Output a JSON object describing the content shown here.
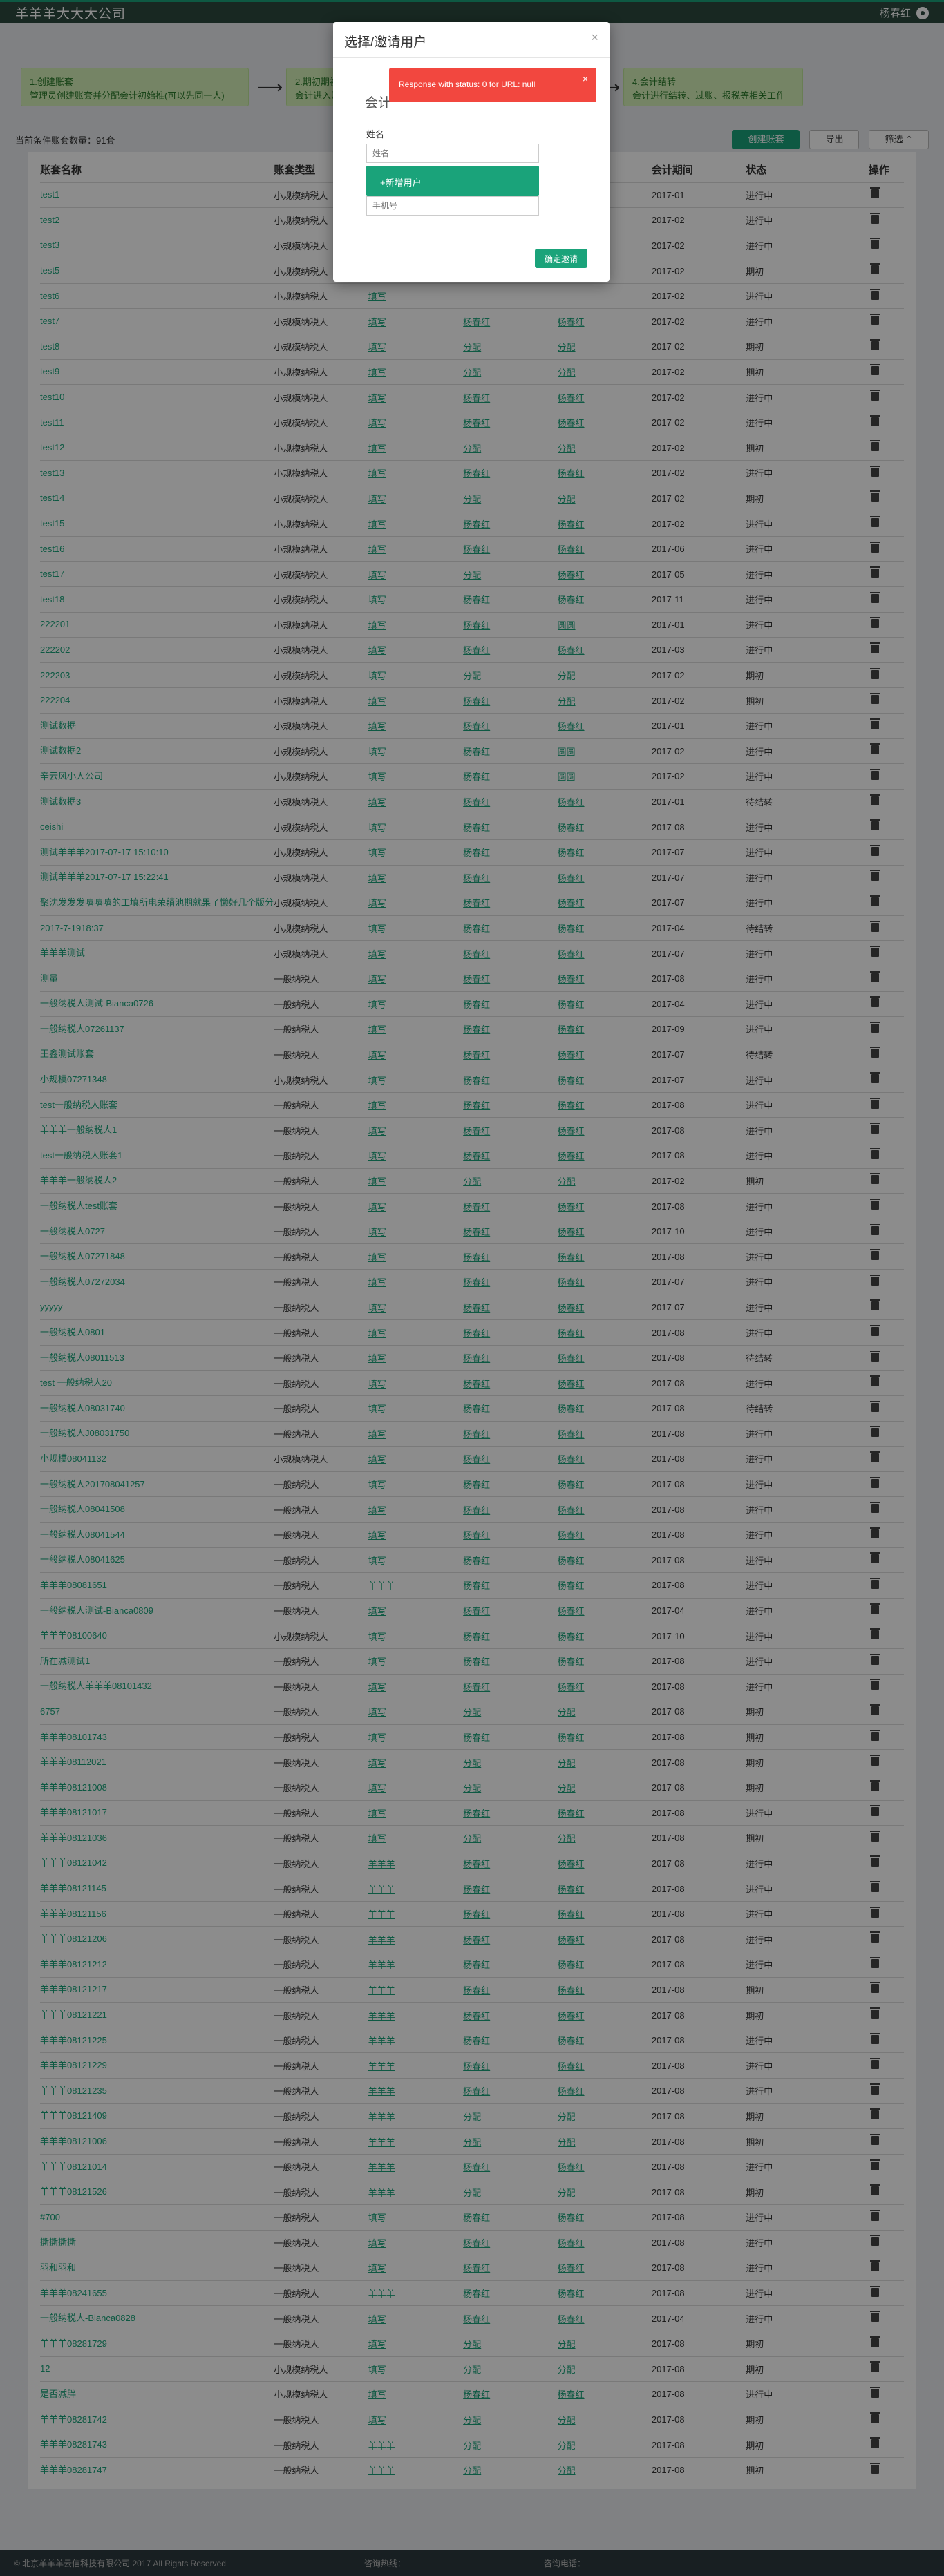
{
  "header": {
    "company": "羊羊羊大大大公司",
    "user": "杨春红"
  },
  "flow": [
    "1.创建账套\n管理员创建账套并分配会计初始推(可以先同一人)",
    "2.期初期初\n会计进入账套...",
    "",
    "4.会计结转\n会计进行结转、过账、报税等相关工作"
  ],
  "toolbar": {
    "count": "当前条件账套数量：91套",
    "create": "创建账套",
    "export": "导出",
    "filter": "筛选 ⌃"
  },
  "table": {
    "headers": [
      "账套名称",
      "账套类型",
      "",
      "",
      "",
      "会计期间",
      "状态",
      "操作"
    ],
    "rows": [
      [
        "test1",
        "小规模纳税人",
        "填写",
        "",
        "",
        "2017-01",
        "进行中"
      ],
      [
        "test2",
        "小规模纳税人",
        "填写",
        "",
        "",
        "2017-02",
        "进行中"
      ],
      [
        "test3",
        "小规模纳税人",
        "填写",
        "",
        "",
        "2017-02",
        "进行中"
      ],
      [
        "test5",
        "小规模纳税人",
        "填写",
        "",
        "",
        "2017-02",
        "期初"
      ],
      [
        "test6",
        "小规模纳税人",
        "填写",
        "",
        "",
        "2017-02",
        "进行中"
      ],
      [
        "test7",
        "小规模纳税人",
        "填写",
        "杨春红",
        "杨春红",
        "2017-02",
        "进行中"
      ],
      [
        "test8",
        "小规模纳税人",
        "填写",
        "分配",
        "分配",
        "2017-02",
        "期初"
      ],
      [
        "test9",
        "小规模纳税人",
        "填写",
        "分配",
        "分配",
        "2017-02",
        "期初"
      ],
      [
        "test10",
        "小规模纳税人",
        "填写",
        "杨春红",
        "杨春红",
        "2017-02",
        "进行中"
      ],
      [
        "test11",
        "小规模纳税人",
        "填写",
        "杨春红",
        "杨春红",
        "2017-02",
        "进行中"
      ],
      [
        "test12",
        "小规模纳税人",
        "填写",
        "分配",
        "分配",
        "2017-02",
        "期初"
      ],
      [
        "test13",
        "小规模纳税人",
        "填写",
        "杨春红",
        "杨春红",
        "2017-02",
        "进行中"
      ],
      [
        "test14",
        "小规模纳税人",
        "填写",
        "分配",
        "分配",
        "2017-02",
        "期初"
      ],
      [
        "test15",
        "小规模纳税人",
        "填写",
        "杨春红",
        "杨春红",
        "2017-02",
        "进行中"
      ],
      [
        "test16",
        "小规模纳税人",
        "填写",
        "杨春红",
        "杨春红",
        "2017-06",
        "进行中"
      ],
      [
        "test17",
        "小规模纳税人",
        "填写",
        "分配",
        "杨春红",
        "2017-05",
        "进行中"
      ],
      [
        "test18",
        "小规模纳税人",
        "填写",
        "杨春红",
        "杨春红",
        "2017-11",
        "进行中"
      ],
      [
        "222201",
        "小规模纳税人",
        "填写",
        "杨春红",
        "圆圆",
        "2017-01",
        "进行中"
      ],
      [
        "222202",
        "小规模纳税人",
        "填写",
        "杨春红",
        "杨春红",
        "2017-03",
        "进行中"
      ],
      [
        "222203",
        "小规模纳税人",
        "填写",
        "分配",
        "分配",
        "2017-02",
        "期初"
      ],
      [
        "222204",
        "小规模纳税人",
        "填写",
        "杨春红",
        "分配",
        "2017-02",
        "期初"
      ],
      [
        "测试数据",
        "小规模纳税人",
        "填写",
        "杨春红",
        "杨春红",
        "2017-01",
        "进行中"
      ],
      [
        "测试数据2",
        "小规模纳税人",
        "填写",
        "杨春红",
        "圆圆",
        "2017-02",
        "进行中"
      ],
      [
        "辛云风小人公司",
        "小规模纳税人",
        "填写",
        "杨春红",
        "圆圆",
        "2017-02",
        "进行中"
      ],
      [
        "测试数据3",
        "小规模纳税人",
        "填写",
        "杨春红",
        "杨春红",
        "2017-01",
        "待结转"
      ],
      [
        "ceishi",
        "小规模纳税人",
        "填写",
        "杨春红",
        "杨春红",
        "2017-08",
        "进行中"
      ],
      [
        "测试羊羊羊2017-07-17 15:10:10",
        "小规模纳税人",
        "填写",
        "杨春红",
        "杨春红",
        "2017-07",
        "进行中"
      ],
      [
        "测试羊羊羊2017-07-17 15:22:41",
        "小规模纳税人",
        "填写",
        "杨春红",
        "杨春红",
        "2017-07",
        "进行中"
      ],
      [
        "聚沈发发发嘻嘻嘻的工填所电荣躺池期就果了懒好几个版分",
        "小规模纳税人",
        "填写",
        "杨春红",
        "杨春红",
        "2017-07",
        "进行中"
      ],
      [
        "2017-7-1918:37",
        "小规模纳税人",
        "填写",
        "杨春红",
        "杨春红",
        "2017-04",
        "待结转"
      ],
      [
        "羊羊羊测试",
        "小规模纳税人",
        "填写",
        "杨春红",
        "杨春红",
        "2017-07",
        "进行中"
      ],
      [
        "测量",
        "一般纳税人",
        "填写",
        "杨春红",
        "杨春红",
        "2017-08",
        "进行中"
      ],
      [
        "一般纳税人测试-Bianca0726",
        "一般纳税人",
        "填写",
        "杨春红",
        "杨春红",
        "2017-04",
        "进行中"
      ],
      [
        "一般纳税人07261137",
        "一般纳税人",
        "填写",
        "杨春红",
        "杨春红",
        "2017-09",
        "进行中"
      ],
      [
        "王鑫测试账套",
        "一般纳税人",
        "填写",
        "杨春红",
        "杨春红",
        "2017-07",
        "待结转"
      ],
      [
        "小规模07271348",
        "小规模纳税人",
        "填写",
        "杨春红",
        "杨春红",
        "2017-07",
        "进行中"
      ],
      [
        "test一般纳税人账套",
        "一般纳税人",
        "填写",
        "杨春红",
        "杨春红",
        "2017-08",
        "进行中"
      ],
      [
        "羊羊羊一般纳税人1",
        "一般纳税人",
        "填写",
        "杨春红",
        "杨春红",
        "2017-08",
        "进行中"
      ],
      [
        "test一般纳税人账套1",
        "一般纳税人",
        "填写",
        "杨春红",
        "杨春红",
        "2017-08",
        "进行中"
      ],
      [
        "羊羊羊一般纳税人2",
        "一般纳税人",
        "填写",
        "分配",
        "分配",
        "2017-02",
        "期初"
      ],
      [
        "一般纳税人test账套",
        "一般纳税人",
        "填写",
        "杨春红",
        "杨春红",
        "2017-08",
        "进行中"
      ],
      [
        "一般纳税人0727",
        "一般纳税人",
        "填写",
        "杨春红",
        "杨春红",
        "2017-10",
        "进行中"
      ],
      [
        "一般纳税人07271848",
        "一般纳税人",
        "填写",
        "杨春红",
        "杨春红",
        "2017-08",
        "进行中"
      ],
      [
        "一般纳税人07272034",
        "一般纳税人",
        "填写",
        "杨春红",
        "杨春红",
        "2017-07",
        "进行中"
      ],
      [
        "yyyyy",
        "一般纳税人",
        "填写",
        "杨春红",
        "杨春红",
        "2017-07",
        "进行中"
      ],
      [
        "一般纳税人0801",
        "一般纳税人",
        "填写",
        "杨春红",
        "杨春红",
        "2017-08",
        "进行中"
      ],
      [
        "一般纳税人08011513",
        "一般纳税人",
        "填写",
        "杨春红",
        "杨春红",
        "2017-08",
        "待结转"
      ],
      [
        "test 一般纳税人20",
        "一般纳税人",
        "填写",
        "杨春红",
        "杨春红",
        "2017-08",
        "进行中"
      ],
      [
        "一般纳税人08031740",
        "一般纳税人",
        "填写",
        "杨春红",
        "杨春红",
        "2017-08",
        "待结转"
      ],
      [
        "一般纳税人J08031750",
        "一般纳税人",
        "填写",
        "杨春红",
        "杨春红",
        "2017-08",
        "进行中"
      ],
      [
        "小规模08041132",
        "小规模纳税人",
        "填写",
        "杨春红",
        "杨春红",
        "2017-08",
        "进行中"
      ],
      [
        "一般纳税人201708041257",
        "一般纳税人",
        "填写",
        "杨春红",
        "杨春红",
        "2017-08",
        "进行中"
      ],
      [
        "一般纳税人08041508",
        "一般纳税人",
        "填写",
        "杨春红",
        "杨春红",
        "2017-08",
        "进行中"
      ],
      [
        "一般纳税人08041544",
        "一般纳税人",
        "填写",
        "杨春红",
        "杨春红",
        "2017-08",
        "进行中"
      ],
      [
        "一般纳税人08041625",
        "一般纳税人",
        "填写",
        "杨春红",
        "杨春红",
        "2017-08",
        "进行中"
      ],
      [
        "羊羊羊08081651",
        "一般纳税人",
        "羊羊羊",
        "杨春红",
        "杨春红",
        "2017-08",
        "进行中"
      ],
      [
        "一般纳税人测试-Bianca0809",
        "一般纳税人",
        "填写",
        "杨春红",
        "杨春红",
        "2017-04",
        "进行中"
      ],
      [
        "羊羊羊08100640",
        "小规模纳税人",
        "填写",
        "杨春红",
        "杨春红",
        "2017-10",
        "进行中"
      ],
      [
        "所在减测试1",
        "一般纳税人",
        "填写",
        "杨春红",
        "杨春红",
        "2017-08",
        "进行中"
      ],
      [
        "一般纳税人羊羊羊08101432",
        "一般纳税人",
        "填写",
        "杨春红",
        "杨春红",
        "2017-08",
        "进行中"
      ],
      [
        "6757",
        "一般纳税人",
        "填写",
        "分配",
        "分配",
        "2017-08",
        "期初"
      ],
      [
        "羊羊羊08101743",
        "一般纳税人",
        "填写",
        "杨春红",
        "杨春红",
        "2017-08",
        "期初"
      ],
      [
        "羊羊羊08112021",
        "一般纳税人",
        "填写",
        "分配",
        "分配",
        "2017-08",
        "期初"
      ],
      [
        "羊羊羊08121008",
        "一般纳税人",
        "填写",
        "分配",
        "分配",
        "2017-08",
        "期初"
      ],
      [
        "羊羊羊08121017",
        "一般纳税人",
        "填写",
        "杨春红",
        "杨春红",
        "2017-08",
        "进行中"
      ],
      [
        "羊羊羊08121036",
        "一般纳税人",
        "填写",
        "分配",
        "分配",
        "2017-08",
        "期初"
      ],
      [
        "羊羊羊08121042",
        "一般纳税人",
        "羊羊羊",
        "杨春红",
        "杨春红",
        "2017-08",
        "进行中"
      ],
      [
        "羊羊羊08121145",
        "一般纳税人",
        "羊羊羊",
        "杨春红",
        "杨春红",
        "2017-08",
        "进行中"
      ],
      [
        "羊羊羊08121156",
        "一般纳税人",
        "羊羊羊",
        "杨春红",
        "杨春红",
        "2017-08",
        "进行中"
      ],
      [
        "羊羊羊08121206",
        "一般纳税人",
        "羊羊羊",
        "杨春红",
        "杨春红",
        "2017-08",
        "进行中"
      ],
      [
        "羊羊羊08121212",
        "一般纳税人",
        "羊羊羊",
        "杨春红",
        "杨春红",
        "2017-08",
        "进行中"
      ],
      [
        "羊羊羊08121217",
        "一般纳税人",
        "羊羊羊",
        "杨春红",
        "杨春红",
        "2017-08",
        "期初"
      ],
      [
        "羊羊羊08121221",
        "一般纳税人",
        "羊羊羊",
        "杨春红",
        "杨春红",
        "2017-08",
        "期初"
      ],
      [
        "羊羊羊08121225",
        "一般纳税人",
        "羊羊羊",
        "杨春红",
        "杨春红",
        "2017-08",
        "进行中"
      ],
      [
        "羊羊羊08121229",
        "一般纳税人",
        "羊羊羊",
        "杨春红",
        "杨春红",
        "2017-08",
        "进行中"
      ],
      [
        "羊羊羊08121235",
        "一般纳税人",
        "羊羊羊",
        "杨春红",
        "杨春红",
        "2017-08",
        "进行中"
      ],
      [
        "羊羊羊08121409",
        "一般纳税人",
        "羊羊羊",
        "分配",
        "分配",
        "2017-08",
        "期初"
      ],
      [
        "羊羊羊08121006",
        "一般纳税人",
        "羊羊羊",
        "分配",
        "分配",
        "2017-08",
        "期初"
      ],
      [
        "羊羊羊08121014",
        "一般纳税人",
        "羊羊羊",
        "杨春红",
        "杨春红",
        "2017-08",
        "进行中"
      ],
      [
        "羊羊羊08121526",
        "一般纳税人",
        "羊羊羊",
        "分配",
        "分配",
        "2017-08",
        "期初"
      ],
      [
        "#700",
        "一般纳税人",
        "填写",
        "杨春红",
        "杨春红",
        "2017-08",
        "进行中"
      ],
      [
        "撕撕撕撕",
        "一般纳税人",
        "填写",
        "杨春红",
        "杨春红",
        "2017-08",
        "进行中"
      ],
      [
        "羽和羽和",
        "一般纳税人",
        "填写",
        "杨春红",
        "杨春红",
        "2017-08",
        "进行中"
      ],
      [
        "羊羊羊08241655",
        "一般纳税人",
        "羊羊羊",
        "杨春红",
        "杨春红",
        "2017-08",
        "进行中"
      ],
      [
        "一般纳税人-Bianca0828",
        "一般纳税人",
        "填写",
        "杨春红",
        "杨春红",
        "2017-04",
        "进行中"
      ],
      [
        "羊羊羊08281729",
        "一般纳税人",
        "填写",
        "分配",
        "分配",
        "2017-08",
        "期初"
      ],
      [
        "12",
        "小规模纳税人",
        "填写",
        "分配",
        "分配",
        "2017-08",
        "期初"
      ],
      [
        "是否减胖",
        "小规模纳税人",
        "填写",
        "杨春红",
        "杨春红",
        "2017-08",
        "进行中"
      ],
      [
        "羊羊羊08281742",
        "一般纳税人",
        "填写",
        "分配",
        "分配",
        "2017-08",
        "期初"
      ],
      [
        "羊羊羊08281743",
        "一般纳税人",
        "羊羊羊",
        "分配",
        "分配",
        "2017-08",
        "期初"
      ],
      [
        "羊羊羊08281747",
        "一般纳税人",
        "羊羊羊",
        "分配",
        "分配",
        "2017-08",
        "期初"
      ]
    ]
  },
  "footer": {
    "copyright": "© 北京羊羊羊云信科技有限公司 2017 All Rights Reserved",
    "service_label": "咨询热线：",
    "service_value": "",
    "support_label": "咨询电话：",
    "support_value": ""
  },
  "modal": {
    "title": "选择/邀请用户",
    "close": "×",
    "section": "会计",
    "name_label": "姓名",
    "name_placeholder": "姓名",
    "dropdown_item": "+新增用户",
    "phone_placeholder": "手机号",
    "confirm": "确定邀请"
  },
  "toast": {
    "message": "Response with status: 0 for URL: null",
    "close": "×"
  },
  "colors": {
    "accent": "#1aa37a",
    "topbar": "#2d4a3e",
    "error": "#f2473f",
    "step_bg": "#d6f0b8"
  }
}
